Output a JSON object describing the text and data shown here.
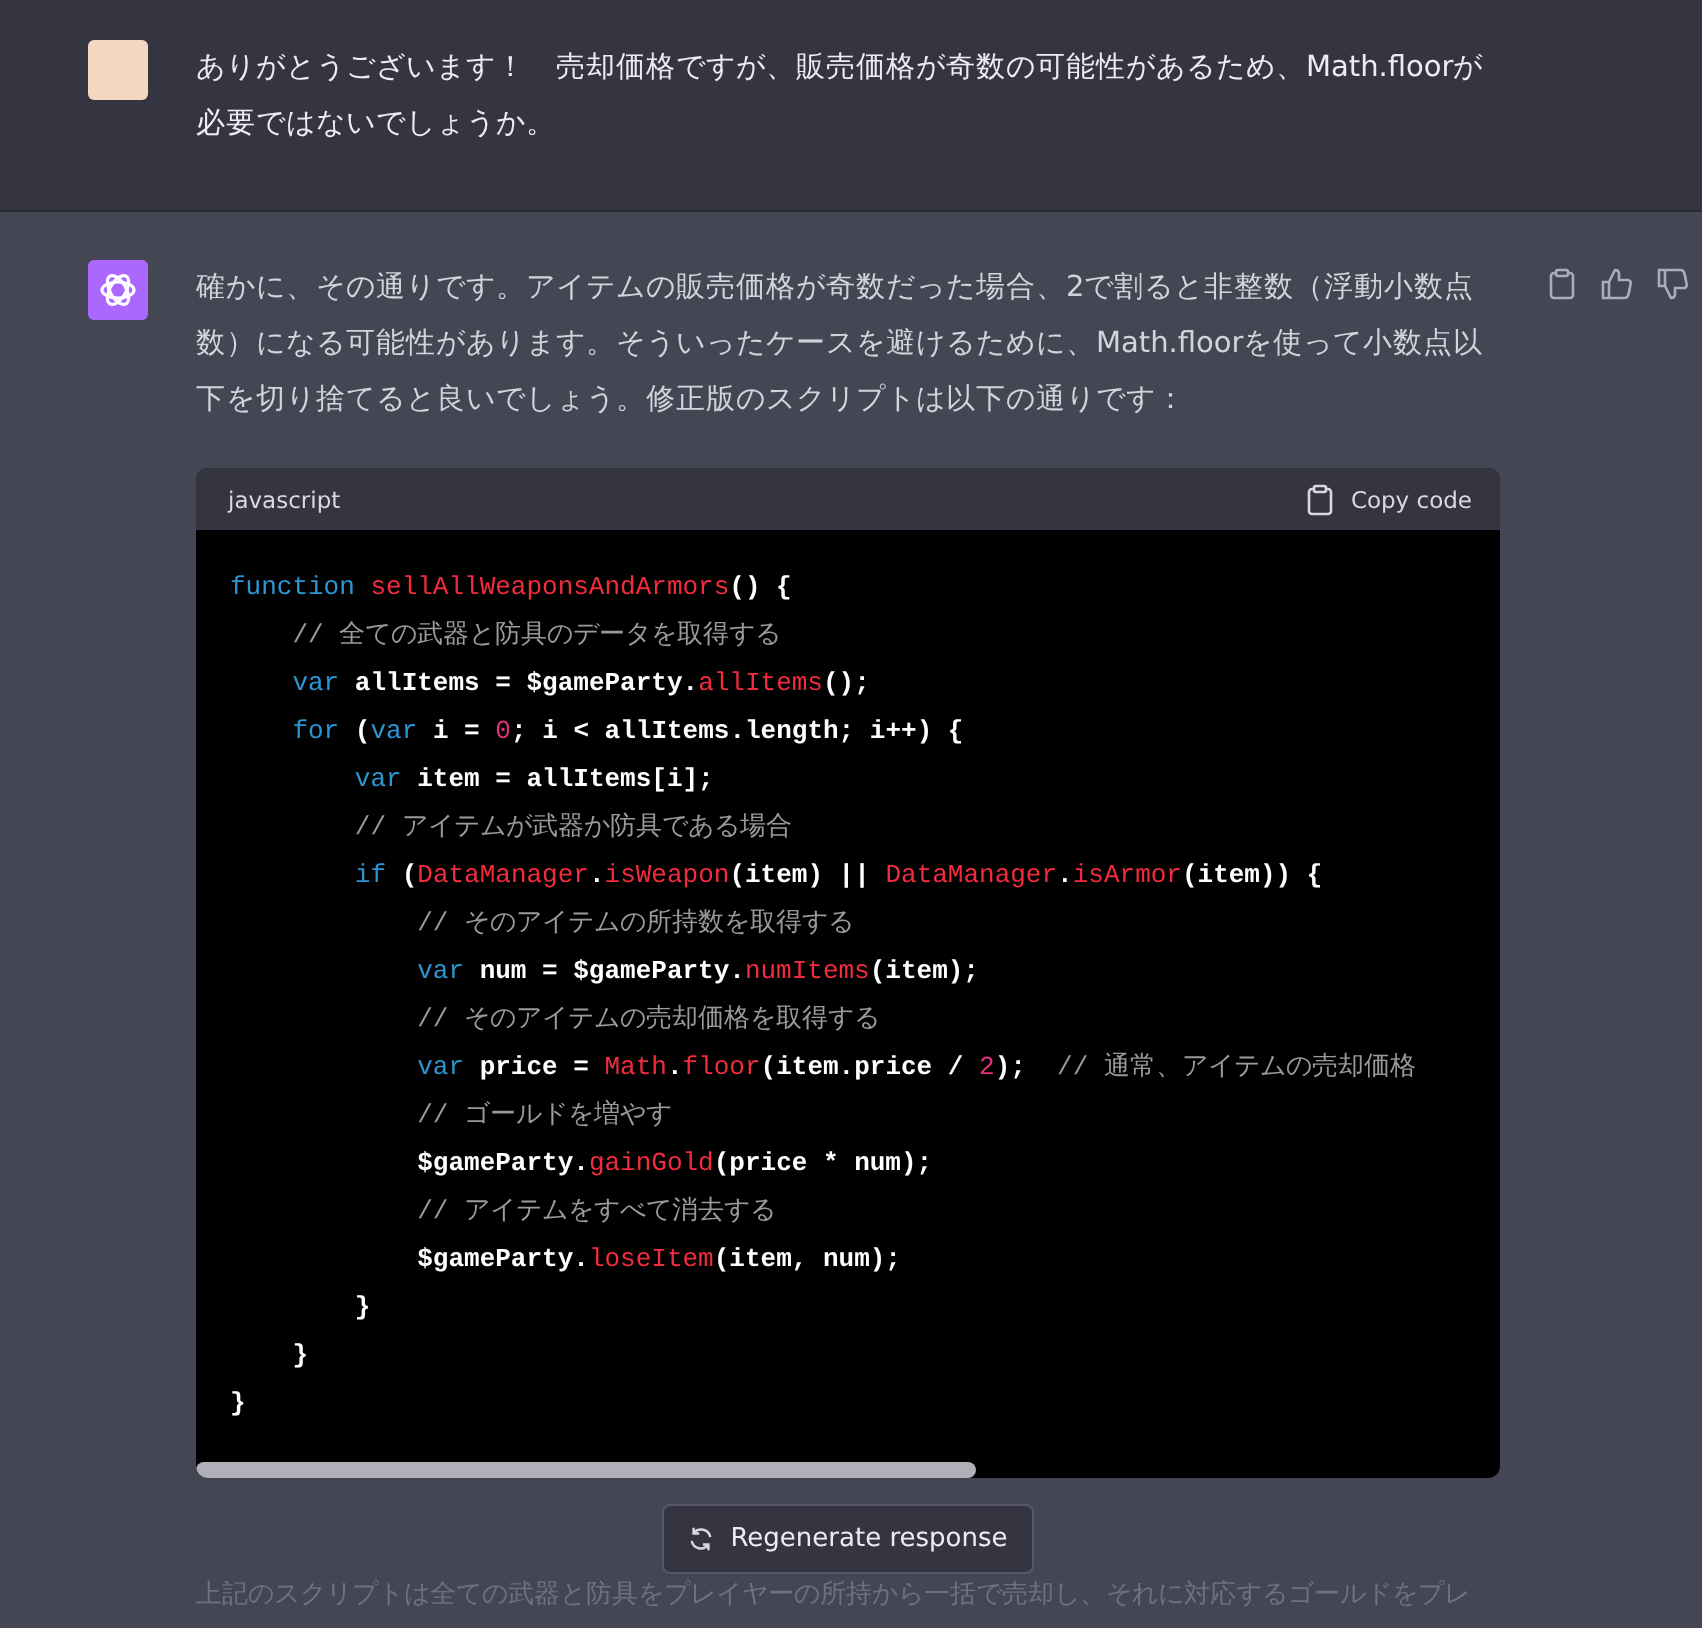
{
  "user_message": {
    "text": "ありがとうございます！　売却価格ですが、販売価格が奇数の可能性があるため、Math.floorが必要ではないでしょうか。"
  },
  "assistant_message": {
    "text": "確かに、その通りです。アイテムの販売価格が奇数だった場合、2で割ると非整数（浮動小数点数）になる可能性があります。そういったケースを避けるために、Math.floorを使って小数点以下を切り捨てると良いでしょう。修正版のスクリプトは以下の通りです：",
    "code_block": {
      "language": "javascript",
      "copy_label": "Copy code",
      "lines": [
        [
          {
            "kind": "keyword",
            "text": "function "
          },
          {
            "kind": "func",
            "text": "sellAllWeaponsAndArmors"
          },
          {
            "kind": "plain",
            "text": "() {"
          }
        ],
        [
          {
            "kind": "comment",
            "text": "    // 全ての武器と防具のデータを取得する"
          }
        ],
        [
          {
            "kind": "keyword",
            "text": "    var "
          },
          {
            "kind": "plain",
            "text": "allItems = $gameParty."
          },
          {
            "kind": "func",
            "text": "allItems"
          },
          {
            "kind": "plain",
            "text": "();"
          }
        ],
        [
          {
            "kind": "keyword",
            "text": "    for "
          },
          {
            "kind": "plain",
            "text": "("
          },
          {
            "kind": "keyword",
            "text": "var "
          },
          {
            "kind": "plain",
            "text": "i = "
          },
          {
            "kind": "number",
            "text": "0"
          },
          {
            "kind": "plain",
            "text": "; i < allItems.length; i++) {"
          }
        ],
        [
          {
            "kind": "keyword",
            "text": "        var "
          },
          {
            "kind": "plain",
            "text": "item = allItems[i];"
          }
        ],
        [
          {
            "kind": "comment",
            "text": "        // アイテムが武器か防具である場合"
          }
        ],
        [
          {
            "kind": "keyword",
            "text": "        if "
          },
          {
            "kind": "plain",
            "text": "("
          },
          {
            "kind": "func",
            "text": "DataManager"
          },
          {
            "kind": "plain",
            "text": "."
          },
          {
            "kind": "func",
            "text": "isWeapon"
          },
          {
            "kind": "plain",
            "text": "(item) || "
          },
          {
            "kind": "func",
            "text": "DataManager"
          },
          {
            "kind": "plain",
            "text": "."
          },
          {
            "kind": "func",
            "text": "isArmor"
          },
          {
            "kind": "plain",
            "text": "(item)) {"
          }
        ],
        [
          {
            "kind": "comment",
            "text": "            // そのアイテムの所持数を取得する"
          }
        ],
        [
          {
            "kind": "keyword",
            "text": "            var "
          },
          {
            "kind": "plain",
            "text": "num = $gameParty."
          },
          {
            "kind": "func",
            "text": "numItems"
          },
          {
            "kind": "plain",
            "text": "(item);"
          }
        ],
        [
          {
            "kind": "comment",
            "text": "            // そのアイテムの売却価格を取得する"
          }
        ],
        [
          {
            "kind": "keyword",
            "text": "            var "
          },
          {
            "kind": "plain",
            "text": "price = "
          },
          {
            "kind": "func",
            "text": "Math"
          },
          {
            "kind": "plain",
            "text": "."
          },
          {
            "kind": "func",
            "text": "floor"
          },
          {
            "kind": "plain",
            "text": "(item.price / "
          },
          {
            "kind": "number",
            "text": "2"
          },
          {
            "kind": "plain",
            "text": ");  "
          },
          {
            "kind": "comment",
            "text": "// 通常、アイテムの売却価格"
          }
        ],
        [
          {
            "kind": "comment",
            "text": "            // ゴールドを増やす"
          }
        ],
        [
          {
            "kind": "plain",
            "text": "            $gameParty."
          },
          {
            "kind": "func",
            "text": "gainGold"
          },
          {
            "kind": "plain",
            "text": "(price * num);"
          }
        ],
        [
          {
            "kind": "comment",
            "text": "            // アイテムをすべて消去する"
          }
        ],
        [
          {
            "kind": "plain",
            "text": "            $gameParty."
          },
          {
            "kind": "func",
            "text": "loseItem"
          },
          {
            "kind": "plain",
            "text": "(item, num);"
          }
        ],
        [
          {
            "kind": "plain",
            "text": "        }"
          }
        ],
        [
          {
            "kind": "plain",
            "text": "    }"
          }
        ],
        [
          {
            "kind": "plain",
            "text": "}"
          }
        ]
      ]
    },
    "trailing_text": "上記のスクリプトは全ての武器と防具をプレイヤーの所持から一括で売却し、それに対応するゴールドをプレ"
  },
  "regenerate_button": {
    "label": "Regenerate response"
  }
}
